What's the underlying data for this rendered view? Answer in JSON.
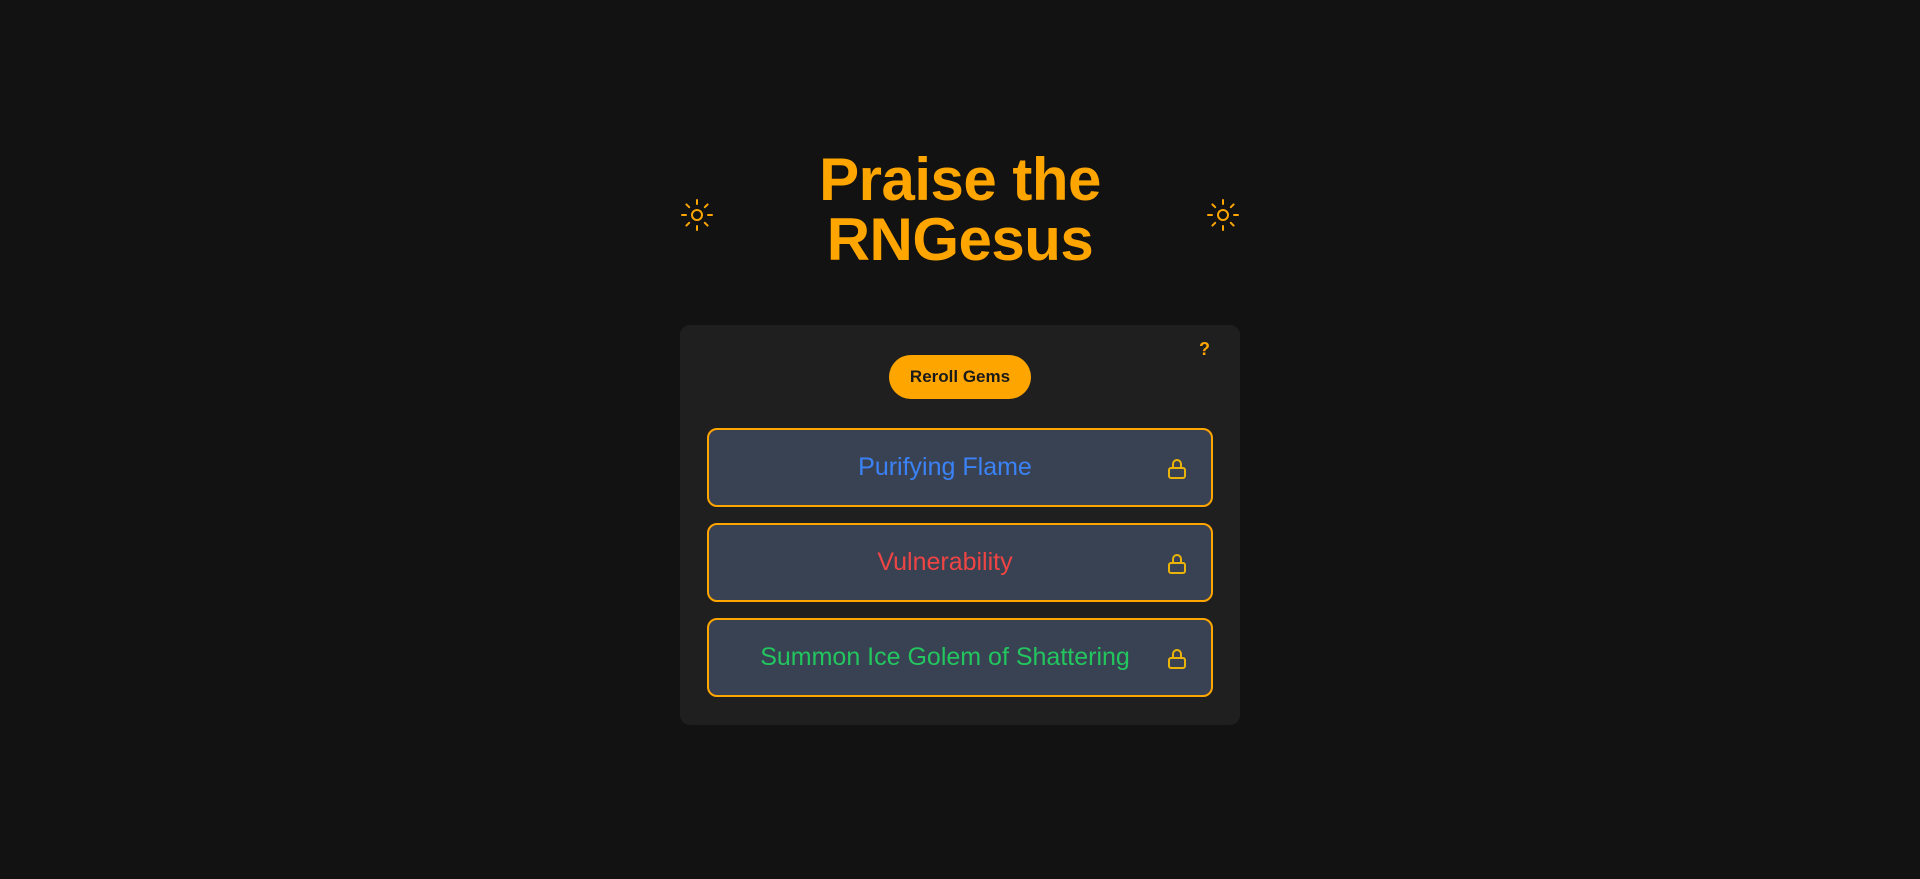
{
  "header": {
    "title_line1": "Praise the",
    "title_line2": "RNGesus",
    "icon": "sun-icon"
  },
  "panel": {
    "help_label": "?",
    "reroll_label": "Reroll Gems",
    "gems": [
      {
        "name": "Purifying Flame",
        "color": "#3B82F6",
        "icon": "lock-icon"
      },
      {
        "name": "Vulnerability",
        "color": "#EF4444",
        "icon": "lock-icon"
      },
      {
        "name": "Summon Ice Golem of Shattering",
        "color": "#22C55E",
        "icon": "lock-icon"
      }
    ]
  },
  "colors": {
    "background": "#121212",
    "panel": "#1F1F1F",
    "accent": "#FFA500",
    "gem_background": "#394253"
  }
}
